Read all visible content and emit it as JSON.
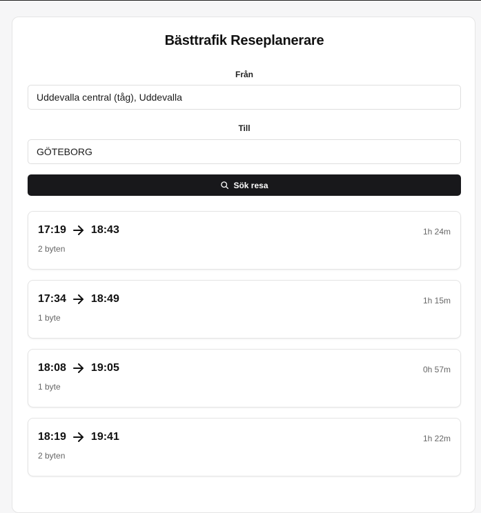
{
  "app": {
    "title": "Bästtrafik Reseplanerare"
  },
  "form": {
    "from_label": "Från",
    "from_value": "Uddevalla central (tåg), Uddevalla",
    "to_label": "Till",
    "to_value": "GÖTEBORG",
    "search_label": "Sök resa"
  },
  "results": [
    {
      "depart": "17:19",
      "arrive": "18:43",
      "changes": "2 byten",
      "duration": "1h 24m"
    },
    {
      "depart": "17:34",
      "arrive": "18:49",
      "changes": "1 byte",
      "duration": "1h 15m"
    },
    {
      "depart": "18:08",
      "arrive": "19:05",
      "changes": "1 byte",
      "duration": "0h 57m"
    },
    {
      "depart": "18:19",
      "arrive": "19:41",
      "changes": "2 byten",
      "duration": "1h 22m"
    }
  ]
}
